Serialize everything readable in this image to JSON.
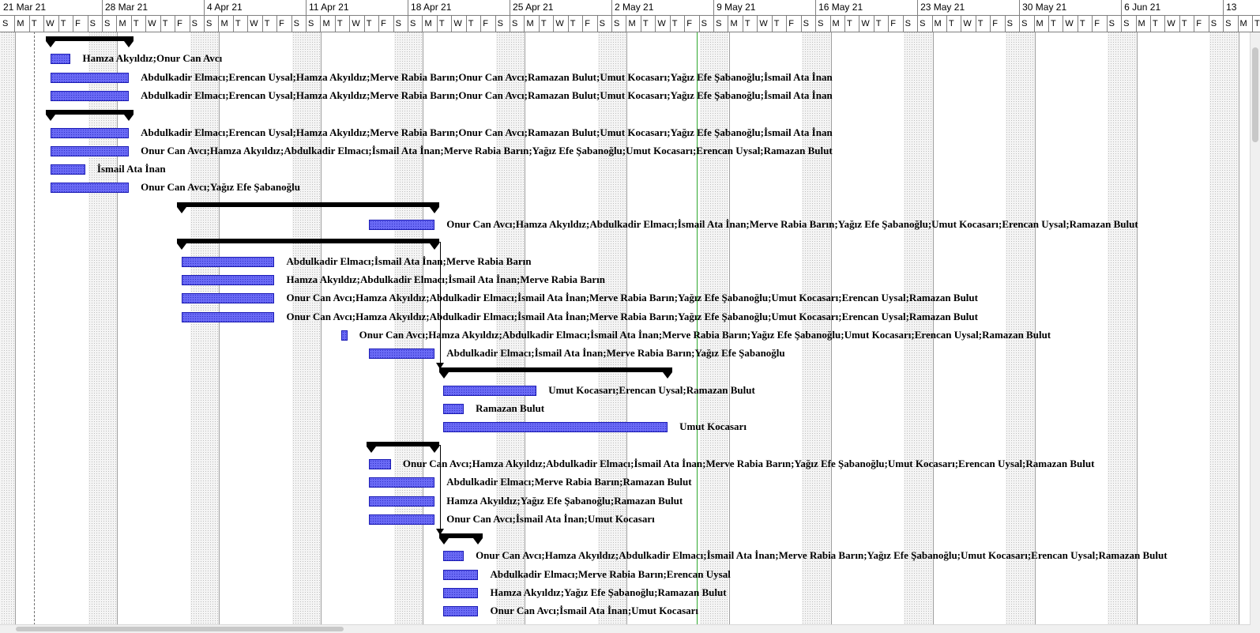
{
  "timescale": {
    "weeks": [
      "21 Mar 21",
      "28 Mar 21",
      "4 Apr 21",
      "11 Apr 21",
      "18 Apr 21",
      "25 Apr 21",
      "2 May 21",
      "9 May 21",
      "16 May 21",
      "23 May 21",
      "30 May 21",
      "6 Jun 21",
      "13"
    ],
    "day_letters": [
      "S",
      "M",
      "T",
      "W",
      "T",
      "F",
      "S"
    ]
  },
  "tasks": [
    {
      "type": "summary",
      "label": ""
    },
    {
      "type": "task",
      "label": "Hamza Akyıldız;Onur Can Avcı"
    },
    {
      "type": "task",
      "label": "Abdulkadir Elmacı;Erencan Uysal;Hamza Akyıldız;Merve Rabia Barın;Onur Can Avcı;Ramazan Bulut;Umut Kocasarı;Yağız Efe Şabanoğlu;İsmail Ata İnan"
    },
    {
      "type": "task",
      "label": "Abdulkadir Elmacı;Erencan Uysal;Hamza Akyıldız;Merve Rabia Barın;Onur Can Avcı;Ramazan Bulut;Umut Kocasarı;Yağız Efe Şabanoğlu;İsmail Ata İnan"
    },
    {
      "type": "summary",
      "label": ""
    },
    {
      "type": "task",
      "label": "Abdulkadir Elmacı;Erencan Uysal;Hamza Akyıldız;Merve Rabia Barın;Onur Can Avcı;Ramazan Bulut;Umut Kocasarı;Yağız Efe Şabanoğlu;İsmail Ata İnan"
    },
    {
      "type": "task",
      "label": "Onur Can Avcı;Hamza Akyıldız;Abdulkadir Elmacı;İsmail Ata İnan;Merve Rabia Barın;Yağız Efe Şabanoğlu;Umut Kocasarı;Erencan Uysal;Ramazan Bulut"
    },
    {
      "type": "task",
      "label": "İsmail Ata İnan"
    },
    {
      "type": "task",
      "label": "Onur Can Avcı;Yağız Efe Şabanoğlu"
    },
    {
      "type": "summary",
      "label": ""
    },
    {
      "type": "task",
      "label": "Onur Can Avcı;Hamza Akyıldız;Abdulkadir Elmacı;İsmail Ata İnan;Merve Rabia Barın;Yağız Efe Şabanoğlu;Umut Kocasarı;Erencan Uysal;Ramazan Bulut"
    },
    {
      "type": "summary",
      "label": ""
    },
    {
      "type": "task",
      "label": "Abdulkadir Elmacı;İsmail Ata İnan;Merve Rabia Barın"
    },
    {
      "type": "task",
      "label": "Hamza Akyıldız;Abdulkadir Elmacı;İsmail Ata İnan;Merve Rabia Barın"
    },
    {
      "type": "task",
      "label": "Onur Can Avcı;Hamza Akyıldız;Abdulkadir Elmacı;İsmail Ata İnan;Merve Rabia Barın;Yağız Efe Şabanoğlu;Umut Kocasarı;Erencan Uysal;Ramazan Bulut"
    },
    {
      "type": "task",
      "label": "Onur Can Avcı;Hamza Akyıldız;Abdulkadir Elmacı;İsmail Ata İnan;Merve Rabia Barın;Yağız Efe Şabanoğlu;Umut Kocasarı;Erencan Uysal;Ramazan Bulut"
    },
    {
      "type": "task",
      "label": "Onur Can Avcı;Hamza Akyıldız;Abdulkadir Elmacı;İsmail Ata İnan;Merve Rabia Barın;Yağız Efe Şabanoğlu;Umut Kocasarı;Erencan Uysal;Ramazan Bulut"
    },
    {
      "type": "task",
      "label": "Abdulkadir Elmacı;İsmail Ata İnan;Merve Rabia Barın;Yağız Efe Şabanoğlu"
    },
    {
      "type": "summary",
      "label": ""
    },
    {
      "type": "task",
      "label": "Umut Kocasarı;Erencan Uysal;Ramazan Bulut"
    },
    {
      "type": "task",
      "label": "Ramazan Bulut"
    },
    {
      "type": "task",
      "label": "Umut Kocasarı"
    },
    {
      "type": "summary",
      "label": ""
    },
    {
      "type": "task",
      "label": "Onur Can Avcı;Hamza Akyıldız;Abdulkadir Elmacı;İsmail Ata İnan;Merve Rabia Barın;Yağız Efe Şabanoğlu;Umut Kocasarı;Erencan Uysal;Ramazan Bulut"
    },
    {
      "type": "task",
      "label": "Abdulkadir Elmacı;Merve Rabia Barın;Ramazan Bulut"
    },
    {
      "type": "task",
      "label": "Hamza Akyıldız;Yağız Efe Şabanoğlu;Ramazan Bulut"
    },
    {
      "type": "task",
      "label": "Onur Can Avcı;İsmail Ata İnan;Umut Kocasarı"
    },
    {
      "type": "summary",
      "label": ""
    },
    {
      "type": "task",
      "label": "Onur Can Avcı;Hamza Akyıldız;Abdulkadir Elmacı;İsmail Ata İnan;Merve Rabia Barın;Yağız Efe Şabanoğlu;Umut Kocasarı;Erencan Uysal;Ramazan Bulut"
    },
    {
      "type": "task",
      "label": "Abdulkadir Elmacı;Merve Rabia Barın;Erencan Uysal"
    },
    {
      "type": "task",
      "label": "Hamza Akyıldız;Yağız Efe Şabanoğlu;Ramazan Bulut"
    },
    {
      "type": "task",
      "label": "Onur Can Avcı;İsmail Ata İnan;Umut Kocasarı"
    }
  ]
}
